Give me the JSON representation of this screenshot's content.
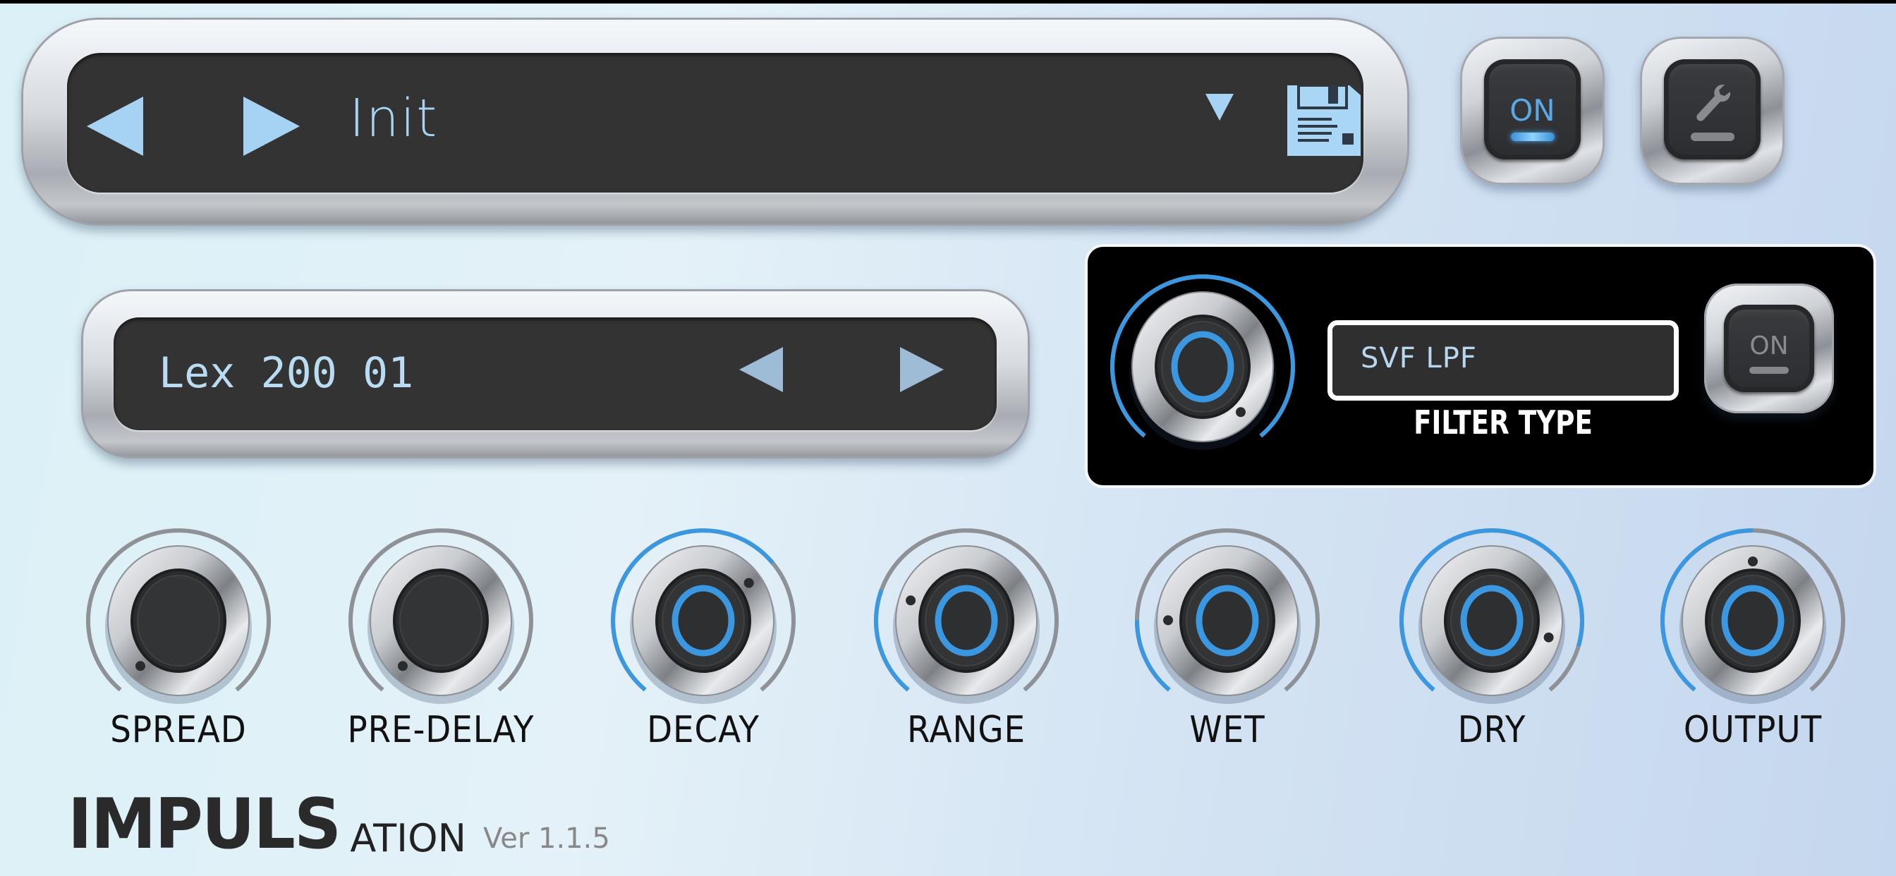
{
  "app": {
    "name_main": "IMPULS",
    "name_sub": "ATION",
    "version": "Ver 1.1.5"
  },
  "colors": {
    "accent": "#3a97e0",
    "display_text": "#a8d4f2",
    "arc_inactive": "#8e9196",
    "panel_bg": "#333333"
  },
  "preset_bar": {
    "prev_icon": "triangle-left-icon",
    "next_icon": "triangle-right-icon",
    "preset_name": "Init",
    "dropdown_icon": "triangle-down-icon",
    "save_icon": "floppy-disk-icon"
  },
  "power_button": {
    "label": "ON",
    "state": "on",
    "led_color": "#4aa6ea"
  },
  "settings_button": {
    "icon": "wrench-icon"
  },
  "impulse_selector": {
    "name": "Lex 200 01",
    "prev_icon": "triangle-left-icon",
    "next_icon": "triangle-right-icon"
  },
  "filter": {
    "type_value": "SVF LPF",
    "label": "FILTER TYPE",
    "knob_value": 1.0,
    "toggle_label": "ON",
    "toggle_state": "off"
  },
  "knobs": [
    {
      "label": "SPREAD",
      "value": 0.0
    },
    {
      "label": "PRE-DELAY",
      "value": 0.0
    },
    {
      "label": "DECAY",
      "value": 0.68
    },
    {
      "label": "RANGE",
      "value": 0.25
    },
    {
      "label": "WET",
      "value": 0.18
    },
    {
      "label": "DRY",
      "value": 0.88
    },
    {
      "label": "OUTPUT",
      "value": 0.5
    }
  ]
}
